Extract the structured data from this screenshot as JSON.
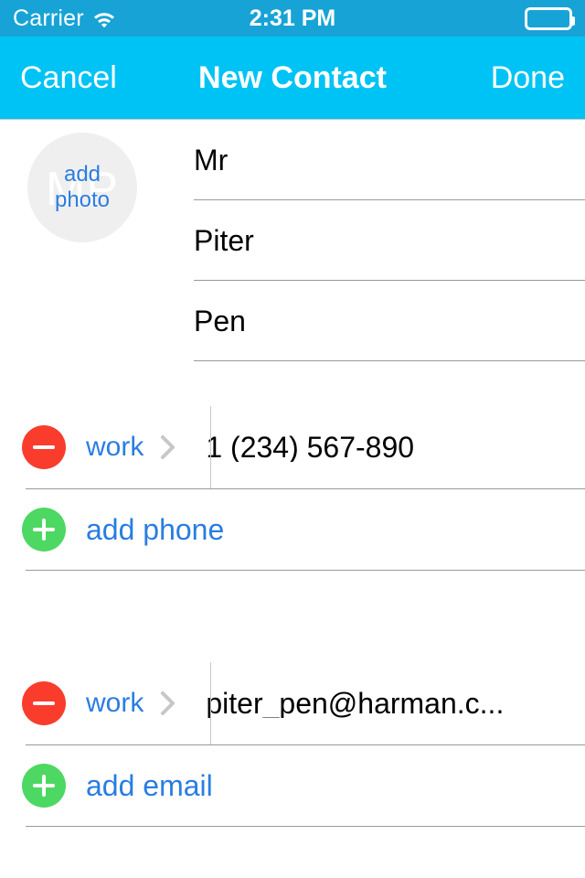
{
  "status_bar": {
    "carrier": "Carrier",
    "wifi_icon": "wifi-icon",
    "time": "2:31 PM",
    "battery_icon": "battery-full-icon",
    "background_color": "#17a3d6"
  },
  "nav_bar": {
    "cancel_label": "Cancel",
    "title": "New Contact",
    "done_label": "Done",
    "background_color": "#00c3f5"
  },
  "photo": {
    "initials": "MP",
    "add_label_line1": "add",
    "add_label_line2": "photo",
    "circle_color": "#efefef",
    "link_color": "#2a7de1"
  },
  "name_fields": [
    {
      "name": "prefix",
      "value": "Mr"
    },
    {
      "name": "first-name",
      "value": "Piter"
    },
    {
      "name": "last-name",
      "value": "Pen"
    }
  ],
  "phone_section": {
    "entries": [
      {
        "remove_icon": "minus-circle-icon",
        "label": "work",
        "chevron_icon": "chevron-right-icon",
        "value": "1 (234) 567-890"
      }
    ],
    "add_icon": "plus-circle-icon",
    "add_label": "add phone"
  },
  "email_section": {
    "entries": [
      {
        "remove_icon": "minus-circle-icon",
        "label": "work",
        "chevron_icon": "chevron-right-icon",
        "value": "piter_pen@harman.c..."
      }
    ],
    "add_icon": "plus-circle-icon",
    "add_label": "add email"
  },
  "colors": {
    "remove_red": "#fa3c2d",
    "add_green": "#4cd862",
    "link_blue": "#2a7de1",
    "separator": "#9a9a9a",
    "chevron_gray": "#c7c7c7"
  }
}
